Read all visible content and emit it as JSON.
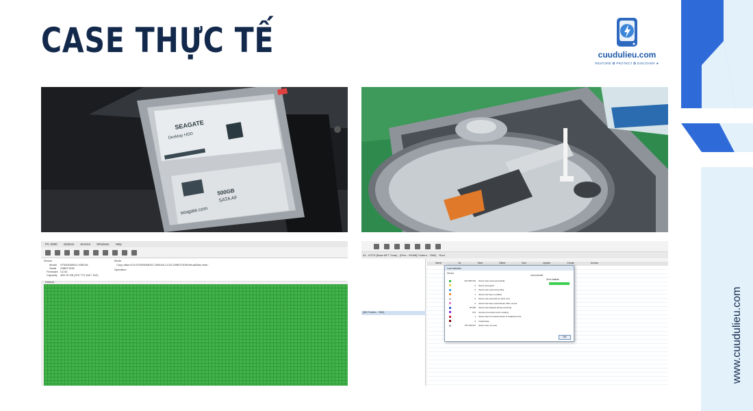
{
  "title": "CASE THỰC TẾ",
  "logo": {
    "name": "cuudulieu.com",
    "tagline": "RESTORE ✪ PROTECT ✪ DISCOVER ★"
  },
  "website": "www.cuudulieu.com",
  "colors": {
    "navy": "#13294b",
    "blue": "#2f6bd8",
    "light_blue": "#e3f1fb",
    "green_block": "#42b24a"
  },
  "photos": {
    "hdd_label": {
      "brand": "SEAGATE",
      "model": "Desktop HDD",
      "capacity": "500GB",
      "interface": "SATA AF",
      "site": "seagate.com"
    },
    "pc3000": {
      "menu": [
        "PC-3000",
        "Options",
        "Service",
        "Windows",
        "Help"
      ],
      "device_header": "Device",
      "mode_header": "Mode",
      "model_label": "Model",
      "model_value": "ST500DM002-1SB10A",
      "serial_label": "Serial",
      "serial_value": "Z9B0T1EW",
      "firmware_label": "Firmware",
      "firmware_value": "CC43",
      "capacity_label": "Capacity",
      "capacity_value": "465.76 GB (976 773 168 * 512)",
      "copy_text": "Copy data to\"D:\\ST500DM002-1SB10A-CC43-Z9B0T1EW\\VirtualDisk.vhdx\"",
      "operation_label": "Operation",
      "default_label": "Default"
    },
    "scan": {
      "path": "04 - NTFS [Base MFT Scan] - [Files - 95988] Folders - 7860]",
      "root_label": "Root",
      "left_item": "[860 Folders - 7860]",
      "columns": [
        "Name",
        "Sz",
        "Start",
        "Offset",
        "Size",
        "Update",
        "Create",
        "Access"
      ],
      "dialog_title": "Last statistics",
      "dialog_section": "Sector",
      "incremental_label": "Incremental",
      "drive_label": "Drive statistic",
      "rows": [
        {
          "count": "222 806 044",
          "label": "Sector was read successfully",
          "color": "#39b54a"
        },
        {
          "count": "0",
          "label": "Sector decrypted",
          "color": "#e8d43a"
        },
        {
          "count": "0",
          "label": "Sector was read using utility",
          "color": "#3aa0e8"
        },
        {
          "count": "1",
          "label": "Sector has been modified",
          "color": "#f08a24"
        },
        {
          "count": "0",
          "label": "Sector was read with an ECC error",
          "color": "#c4c4c4"
        },
        {
          "count": "0",
          "label": "Sector has been read without CRC control",
          "color": "#e87ad0"
        },
        {
          "count": "20 946",
          "label": "Sector was skipped during scanning",
          "color": "#3357d1"
        },
        {
          "count": "973",
          "label": "Access prevented sector reading",
          "color": "#8a2be2"
        },
        {
          "count": "1",
          "label": "Sector was not read because of readiness loss",
          "color": "#c41e3a"
        },
        {
          "count": "0",
          "label": "Invalid data",
          "color": "#7a0000"
        },
        {
          "count": "752 169 611",
          "label": "Sector was not read",
          "color": "#b9b9b9"
        }
      ],
      "ok_label": "OK"
    }
  }
}
